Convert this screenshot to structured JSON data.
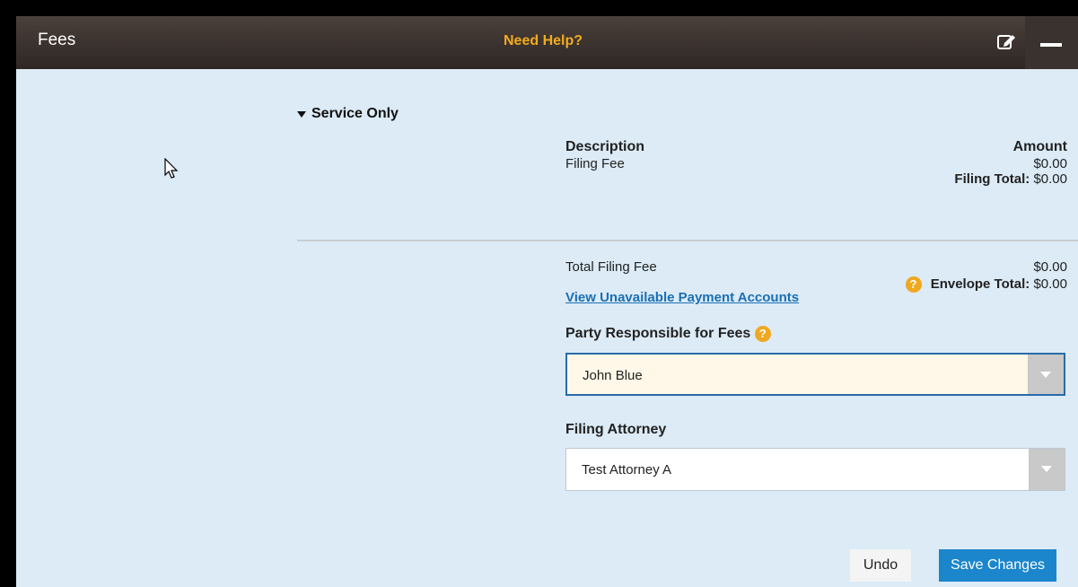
{
  "header": {
    "title": "Fees",
    "help_label": "Need Help?"
  },
  "section": {
    "title": "Service Only"
  },
  "fee_table": {
    "description_header": "Description",
    "amount_header": "Amount",
    "rows": [
      {
        "description": "Filing Fee",
        "amount": "$0.00"
      }
    ],
    "filing_total_label": "Filing Total:",
    "filing_total_value": "$0.00"
  },
  "totals": {
    "total_filing_fee_label": "Total Filing Fee",
    "total_filing_fee_value": "$0.00",
    "view_accounts_link": "View Unavailable Payment Accounts",
    "envelope_total_label": "Envelope Total:",
    "envelope_total_value": "$0.00"
  },
  "party": {
    "label": "Party Responsible for Fees",
    "selected": "John Blue"
  },
  "attorney": {
    "label": "Filing Attorney",
    "selected": "Test Attorney A"
  },
  "actions": {
    "undo_label": "Undo",
    "save_label": "Save Changes"
  },
  "icons": {
    "help": "question-circle-icon",
    "edit": "edit-icon",
    "minimize": "minimize-icon"
  },
  "colors": {
    "header_bg": "#3a322e",
    "panel_bg": "#dcebf6",
    "help_text": "#f3ab1e",
    "link": "#1a6fb5",
    "primary_button": "#1b86cc",
    "selected_field_bg": "#fff8e8"
  }
}
